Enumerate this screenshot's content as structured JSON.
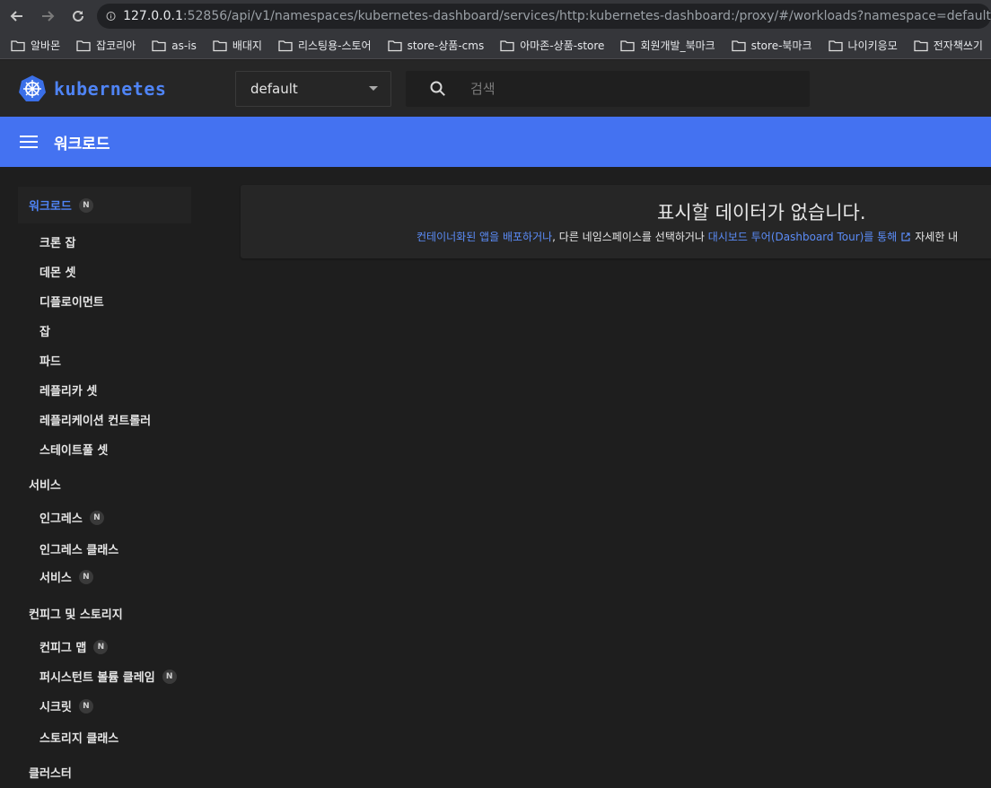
{
  "browser": {
    "url_host": "127.0.0.1",
    "url_rest": ":52856/api/v1/namespaces/kubernetes-dashboard/services/http:kubernetes-dashboard:/proxy/#/workloads?namespace=default",
    "bookmarks": [
      "알바몬",
      "잡코리아",
      "as-is",
      "배대지",
      "리스팅용-스토어",
      "store-상품-cms",
      "아마존-상품-store",
      "회원개발_북마크",
      "store-북마크",
      "나이키응모",
      "전자책쓰기"
    ]
  },
  "header": {
    "brand": "kubernetes",
    "namespace": "default",
    "search_placeholder": "검색"
  },
  "toolbar": {
    "title": "워크로드"
  },
  "sidebar": {
    "workloads": {
      "label": "워크로드",
      "badge": "N"
    },
    "workload_items": [
      "크론 잡",
      "데몬 셋",
      "디플로이먼트",
      "잡",
      "파드",
      "레플리카 셋",
      "레플리케이션 컨트롤러",
      "스테이트풀 셋"
    ],
    "services": {
      "label": "서비스"
    },
    "service_items": [
      {
        "label": "인그레스",
        "badge": "N"
      },
      {
        "label": "인그레스 클래스"
      },
      {
        "label": "서비스",
        "badge": "N"
      }
    ],
    "config": {
      "label": "컨피그 및 스토리지"
    },
    "config_items": [
      {
        "label": "컨피그 맵",
        "badge": "N"
      },
      {
        "label": "퍼시스턴트 볼륨 클레임",
        "badge": "N"
      },
      {
        "label": "시크릿",
        "badge": "N"
      },
      {
        "label": "스토리지 클래스"
      }
    ],
    "cluster": {
      "label": "클러스터"
    }
  },
  "empty_state": {
    "headline": "표시할 데이터가 없습니다.",
    "link1": "컨테이너화된 앱을 배포하거나",
    "text1": ", 다른 네임스페이스를 선택하거나 ",
    "link2": "대시보드 투어(Dashboard Tour)를 통해",
    "text2": "자세한 내"
  },
  "colors": {
    "accent": "#4472f1",
    "link": "#5b8cf7"
  }
}
